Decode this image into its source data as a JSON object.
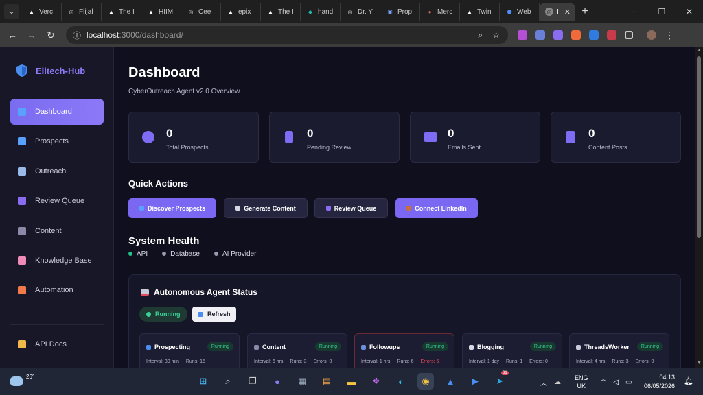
{
  "browser": {
    "tabs": [
      {
        "title": "Verc",
        "color": "#ffffff",
        "glyph": "▲"
      },
      {
        "title": "Flijal",
        "color": "#cfcfcf",
        "glyph": "◎"
      },
      {
        "title": "The I",
        "color": "#ffffff",
        "glyph": "▲"
      },
      {
        "title": "HIIM",
        "color": "#ffffff",
        "glyph": "▲"
      },
      {
        "title": "Cee",
        "color": "#cfcfcf",
        "glyph": "◎"
      },
      {
        "title": "epix",
        "color": "#ffffff",
        "glyph": "▲"
      },
      {
        "title": "The I",
        "color": "#ffffff",
        "glyph": "▲"
      },
      {
        "title": "hand",
        "color": "#1fbfb0",
        "glyph": "◆"
      },
      {
        "title": "Dr. Y",
        "color": "#cfcfcf",
        "glyph": "◎"
      },
      {
        "title": "Prop",
        "color": "#7aa7ff",
        "glyph": "▣"
      },
      {
        "title": "Merc",
        "color": "#d06a50",
        "glyph": "●"
      },
      {
        "title": "Twin",
        "color": "#ffffff",
        "glyph": "▲"
      },
      {
        "title": "Web",
        "color": "#4f8ef7",
        "glyph": "⬟"
      }
    ],
    "active_tab_title": "I",
    "url_host": "localhost",
    "url_path": ":3000/dashboard/"
  },
  "brand": {
    "name": "Elitech-Hub"
  },
  "nav": [
    {
      "label": "Dashboard",
      "icon": "chart-icon",
      "color": "#5aa0ff"
    },
    {
      "label": "Prospects",
      "icon": "magnifier-icon",
      "color": "#5aa0ff"
    },
    {
      "label": "Outreach",
      "icon": "envelope-icon",
      "color": "#9ab8e8"
    },
    {
      "label": "Review Queue",
      "icon": "person-icon",
      "color": "#8a6cf0"
    },
    {
      "label": "Content",
      "icon": "document-icon",
      "color": "#8a8aa8"
    },
    {
      "label": "Knowledge Base",
      "icon": "brain-icon",
      "color": "#f08ab8"
    },
    {
      "label": "Automation",
      "icon": "clock-icon",
      "color": "#f07a4a"
    }
  ],
  "nav_bottom": {
    "label": "API Docs",
    "icon": "book-icon",
    "color": "#f0b84a"
  },
  "page": {
    "title": "Dashboard",
    "subtitle": "CyberOutreach Agent v2.0 Overview"
  },
  "stats": [
    {
      "value": "0",
      "label": "Total Prospects",
      "icon": "search-icon"
    },
    {
      "value": "0",
      "label": "Pending Review",
      "icon": "hourglass-icon"
    },
    {
      "value": "0",
      "label": "Emails Sent",
      "icon": "mail-icon"
    },
    {
      "value": "0",
      "label": "Content Posts",
      "icon": "post-icon"
    }
  ],
  "quick_actions": {
    "title": "Quick Actions",
    "buttons": [
      {
        "label": "Discover Prospects",
        "style": "primary",
        "icon_color": "#5aa0ff"
      },
      {
        "label": "Generate Content",
        "style": "secondary",
        "icon_color": "#d9d9e6"
      },
      {
        "label": "Review Queue",
        "style": "secondary",
        "icon_color": "#8a6cf0"
      },
      {
        "label": "Connect LinkedIn",
        "style": "primary",
        "icon_color": "#c8703a"
      }
    ]
  },
  "system_health": {
    "title": "System Health",
    "items": [
      {
        "label": "API",
        "color": "#22c08a"
      },
      {
        "label": "Database",
        "color": "#9a9ab0"
      },
      {
        "label": "AI Provider",
        "color": "#9a9ab0"
      }
    ]
  },
  "agent_status": {
    "title": "Autonomous Agent Status",
    "state": "Running",
    "refresh_label": "Refresh",
    "workers": [
      {
        "name": "Prospecting",
        "status": "Running",
        "interval": "Interval: 30 min",
        "runs": "Runs: 15",
        "errors": "",
        "error_flag": false
      },
      {
        "name": "Content",
        "status": "Running",
        "interval": "Interval: 6 hrs",
        "runs": "Runs: 3",
        "errors": "Errors: 0",
        "error_flag": false
      },
      {
        "name": "Followups",
        "status": "Running",
        "interval": "Interval: 1 hrs",
        "runs": "Runs: 6",
        "errors": "Errors: 6",
        "error_flag": true
      },
      {
        "name": "Blogging",
        "status": "Running",
        "interval": "Interval: 1 day",
        "runs": "Runs: 1",
        "errors": "Errors: 0",
        "error_flag": false
      },
      {
        "name": "ThreadsWorker",
        "status": "Running",
        "interval": "Interval: 4 hrs",
        "runs": "Runs: 3",
        "errors": "Errors: 0",
        "error_flag": false
      }
    ]
  },
  "taskbar": {
    "temperature": "26°",
    "lang_top": "ENG",
    "lang_bottom": "UK",
    "time": "04:13",
    "date": "06/05/2026",
    "telegram_badge": "31"
  }
}
